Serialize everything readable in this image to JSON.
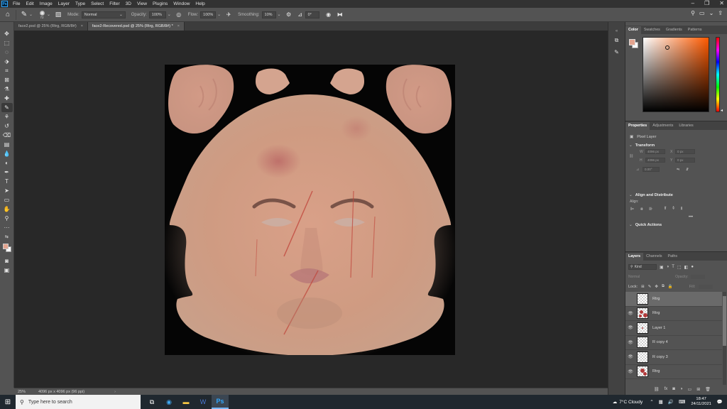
{
  "menubar": {
    "logo_label": "Ps",
    "items": [
      "File",
      "Edit",
      "Image",
      "Layer",
      "Type",
      "Select",
      "Filter",
      "3D",
      "View",
      "Plugins",
      "Window",
      "Help"
    ]
  },
  "options": {
    "brush_size": "72",
    "mode_label": "Mode:",
    "mode_value": "Normal",
    "opacity_label": "Opacity:",
    "opacity_value": "100%",
    "flow_label": "Flow:",
    "flow_value": "100%",
    "smoothing_label": "Smoothing:",
    "smoothing_value": "10%",
    "angle_value": "0°"
  },
  "tabs": [
    {
      "label": "face2.psd @ 25% (Rtrg, RGB/8#)",
      "close": "×"
    },
    {
      "label": "face2-Recovered.psd @ 25% (Rtrg, RGB/8#) *",
      "close": "×"
    }
  ],
  "status": {
    "zoom": "25%",
    "doc_info": "4096 px x 4096 px (96 ppi)",
    "chevron": "›"
  },
  "panels": {
    "color_tabs": [
      "Color",
      "Swatches",
      "Gradients",
      "Patterns"
    ],
    "properties_tabs": [
      "Properties",
      "Adjustments",
      "Libraries"
    ],
    "pixel_layer_label": "Pixel Layer",
    "transform_label": "Transform",
    "transform_fields": {
      "w_label": "W",
      "h_label": "H",
      "x_label": "X",
      "y_label": "Y",
      "w_value": "4096 px",
      "h_value": "4096 px",
      "x_value": "0 px",
      "y_value": "0 px",
      "angle_value": "0.00°"
    },
    "align_label": "Align and Distribute",
    "align_sub": "Align:",
    "more": "•••",
    "quick_actions_label": "Quick Actions",
    "layers_tabs": [
      "Layers",
      "Channels",
      "Paths"
    ],
    "kind_label": "Kind",
    "blend_mode": "Normal",
    "opacity_label": "Opacity:",
    "lock_label": "Lock:",
    "fill_label": "Fill:"
  },
  "layers": [
    {
      "name": "Rtrg",
      "visible": false,
      "selected": true,
      "thumb": "blank"
    },
    {
      "name": "Rtrg",
      "visible": true,
      "selected": false,
      "thumb": "red-spots"
    },
    {
      "name": "Layer 1",
      "visible": true,
      "selected": false,
      "thumb": "dot"
    },
    {
      "name": "R copy 4",
      "visible": true,
      "selected": false,
      "thumb": "blank"
    },
    {
      "name": "R copy 3",
      "visible": true,
      "selected": false,
      "thumb": "blank"
    },
    {
      "name": "Rtrg",
      "visible": true,
      "selected": false,
      "thumb": "red-spots"
    }
  ],
  "colors": {
    "foreground": "#e3a48f",
    "hue": "#ff5a00",
    "accent": "#31a8ff"
  },
  "taskbar": {
    "search_placeholder": "Type here to search",
    "weather": "7°C  Cloudy",
    "time": "18:47",
    "date": "24/11/2021"
  }
}
